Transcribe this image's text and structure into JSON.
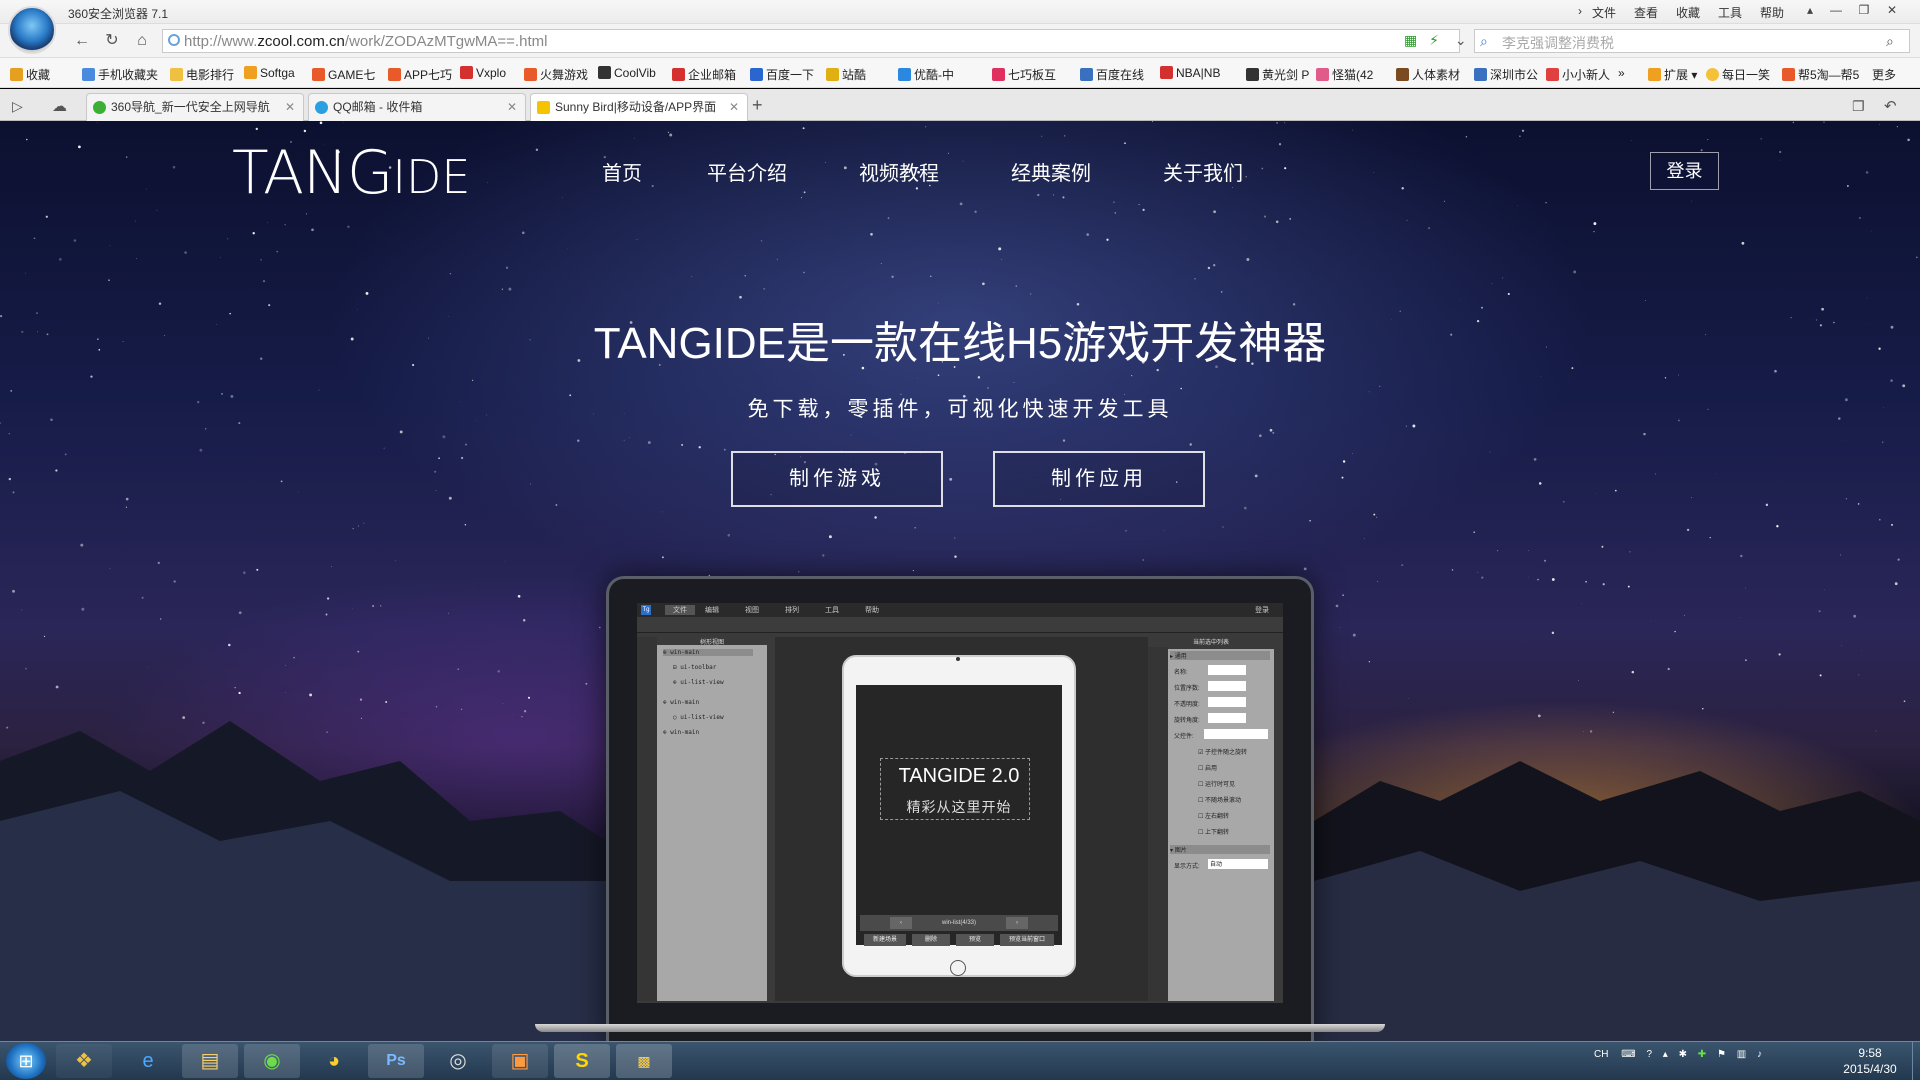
{
  "browser": {
    "app_title": "360安全浏览器 7.1",
    "menu": [
      "文件",
      "查看",
      "收藏",
      "工具",
      "帮助"
    ],
    "url_prefix": "http://www.",
    "url_domain": "zcool.com.cn",
    "url_path": "/work/ZODAzMTgwMA==.html",
    "search_placeholder": "李克强调整消费税",
    "bookmarks": [
      "收藏",
      "手机收藏夹",
      "电影排行",
      "Softga",
      "GAME七",
      "APP七巧",
      "Vxplo",
      "火舞游戏",
      "CoolVib",
      "企业邮箱",
      "百度一下",
      "站酷",
      "优酷-中",
      "七巧板互",
      "百度在线",
      "NBA|NB",
      "黄光剑 P",
      "怪猫(42",
      "人体素材",
      "深圳市公",
      "小小新人"
    ],
    "bookmark_right": [
      "扩展",
      "每日一笑",
      "帮5淘—帮5",
      "更多"
    ],
    "tabs": [
      {
        "label": "360导航_新一代安全上网导航",
        "active": false
      },
      {
        "label": "QQ邮箱 - 收件箱",
        "active": false
      },
      {
        "label": "Sunny Bird|移动设备/APP界面",
        "active": true
      }
    ]
  },
  "site": {
    "logo_main": "TANG",
    "logo_suffix": "IDE",
    "nav": [
      "首页",
      "平台介绍",
      "视频教程",
      "经典案例",
      "关于我们"
    ],
    "login": "登录",
    "headline": "TANGIDE是一款在线H5游戏开发神器",
    "subline": "免下载，零插件，可视化快速开发工具",
    "cta_game": "制作游戏",
    "cta_app": "制作应用"
  },
  "ide": {
    "menubar": [
      "文件",
      "编辑",
      "视图",
      "排列",
      "工具",
      "帮助"
    ],
    "login_label": "登录",
    "left_panel_title": "树形视图",
    "tree": [
      "win-main",
      "ui-toolbar",
      "ui-list-view",
      "win-main",
      "ui-list-view",
      "win-main"
    ],
    "right_panel_title": "当前选中列表",
    "right_section_general": "通用",
    "props": [
      "名称:",
      "位置序数:",
      "不透明度:",
      "旋转角度:",
      "父控件:"
    ],
    "checks": [
      "子控件随之旋转",
      "启用",
      "运行时可见",
      "不随场景滚动",
      "左右翻转",
      "上下翻转"
    ],
    "right_section_image": "图片",
    "display_mode_label": "显示方式:",
    "display_mode_value": "自动",
    "tablet_title": "TANGIDE 2.0",
    "tablet_sub": "精彩从这里开始",
    "pager_label": "win-list(4/33)",
    "tablet_buttons": [
      "新建场景",
      "删除",
      "预览",
      "预览当前窗口"
    ]
  },
  "taskbar": {
    "tray_lang": "CH",
    "time": "9:58",
    "date": "2015/4/30"
  },
  "colors": {
    "page_bg": "#0c1030",
    "taskbar": "#22384f",
    "accent_white": "#ffffff"
  }
}
